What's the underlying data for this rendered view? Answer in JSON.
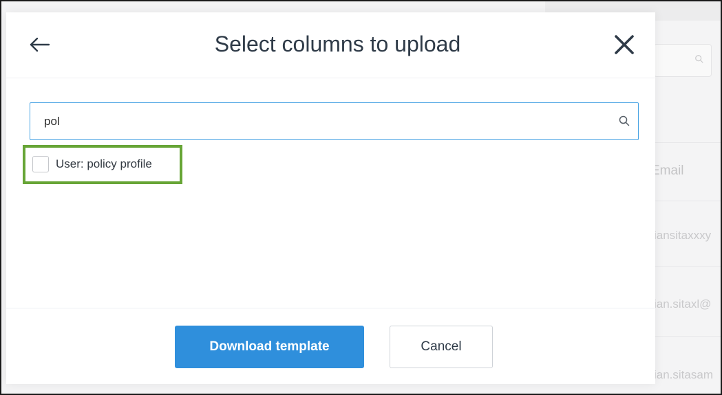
{
  "modal": {
    "title": "Select columns to upload",
    "back_icon": "arrow-left-icon",
    "close_icon": "close-icon"
  },
  "search": {
    "value": "pol",
    "icon": "search-icon"
  },
  "results": [
    {
      "label": "User: policy profile",
      "checked": false
    }
  ],
  "footer": {
    "primary_label": "Download template",
    "secondary_label": "Cancel"
  },
  "background": {
    "column_header": "Email",
    "cells": [
      "iansitaxxxy",
      "ian.sitaxl@",
      "ian.sitasam"
    ]
  },
  "colors": {
    "primary": "#2f8fdc",
    "highlight": "#67a536",
    "search_border": "#46a2e3"
  }
}
